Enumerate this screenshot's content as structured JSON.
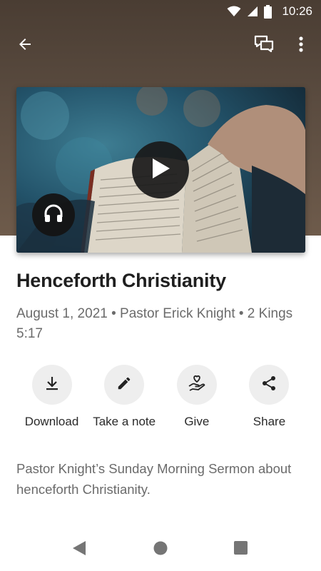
{
  "status_bar": {
    "time": "10:26",
    "icons": [
      "wifi-icon",
      "cell-signal-icon",
      "battery-icon"
    ]
  },
  "app_bar": {
    "icons": [
      "arrow-back-icon",
      "chat-icon",
      "more-vert-icon"
    ]
  },
  "media": {
    "image_subject": "hands holding an open bible",
    "play_icon": "play-icon",
    "audio_icon": "headphones-icon"
  },
  "sermon": {
    "title": "Henceforth Christianity",
    "meta": "August 1, 2021 • Pastor Erick Knight • 2 Kings 5:17",
    "description": "Pastor Knight’s Sunday Morning Sermon about henceforth Christianity."
  },
  "actions": [
    {
      "label": "Download",
      "icon": "download-icon"
    },
    {
      "label": "Take a note",
      "icon": "pencil-icon"
    },
    {
      "label": "Give",
      "icon": "give-heart-hand-icon"
    },
    {
      "label": "Share",
      "icon": "share-icon"
    }
  ],
  "colors": {
    "header_background": "#5b4c40",
    "action_circle": "#eeeeee",
    "secondary_text": "#6b6b6b"
  }
}
